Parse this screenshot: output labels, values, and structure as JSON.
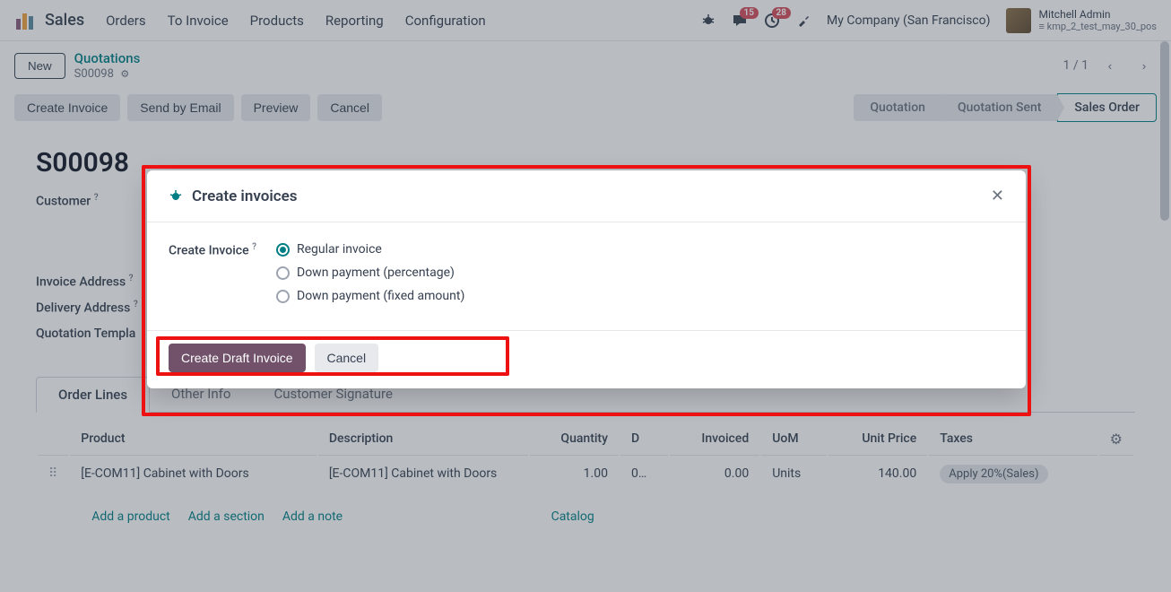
{
  "nav": {
    "app": "Sales",
    "items": [
      "Orders",
      "To Invoice",
      "Products",
      "Reporting",
      "Configuration"
    ],
    "msg_badge": "15",
    "activity_badge": "28",
    "company": "My Company (San Francisco)",
    "username": "Mitchell Admin",
    "dbname": "kmp_2_test_may_30_pos"
  },
  "cp": {
    "new": "New",
    "bc_parent": "Quotations",
    "bc_current": "S00098",
    "pager": "1 / 1"
  },
  "actions": {
    "create_invoice": "Create Invoice",
    "send_email": "Send by Email",
    "preview": "Preview",
    "cancel": "Cancel",
    "status": [
      "Quotation",
      "Quotation Sent",
      "Sales Order"
    ]
  },
  "form": {
    "title": "S00098",
    "customer_label": "Customer",
    "invoice_addr_label": "Invoice Address",
    "delivery_addr_label": "Delivery Address",
    "quote_tmpl_label": "Quotation Templa"
  },
  "tabs": [
    "Order Lines",
    "Other Info",
    "Customer Signature"
  ],
  "table": {
    "headers": {
      "product": "Product",
      "description": "Description",
      "quantity": "Quantity",
      "d": "D",
      "invoiced": "Invoiced",
      "uom": "UoM",
      "unit_price": "Unit Price",
      "taxes": "Taxes"
    },
    "row": {
      "product": "[E-COM11] Cabinet with Doors",
      "description": "[E-COM11] Cabinet with Doors",
      "quantity": "1.00",
      "d": "0…",
      "invoiced": "0.00",
      "uom": "Units",
      "unit_price": "140.00",
      "tax": "Apply 20%(Sales)"
    },
    "add_product": "Add a product",
    "add_section": "Add a section",
    "add_note": "Add a note",
    "catalog": "Catalog"
  },
  "modal": {
    "title": "Create invoices",
    "field_label": "Create Invoice",
    "options": [
      "Regular invoice",
      "Down payment (percentage)",
      "Down payment (fixed amount)"
    ],
    "btn_create": "Create Draft Invoice",
    "btn_cancel": "Cancel"
  }
}
